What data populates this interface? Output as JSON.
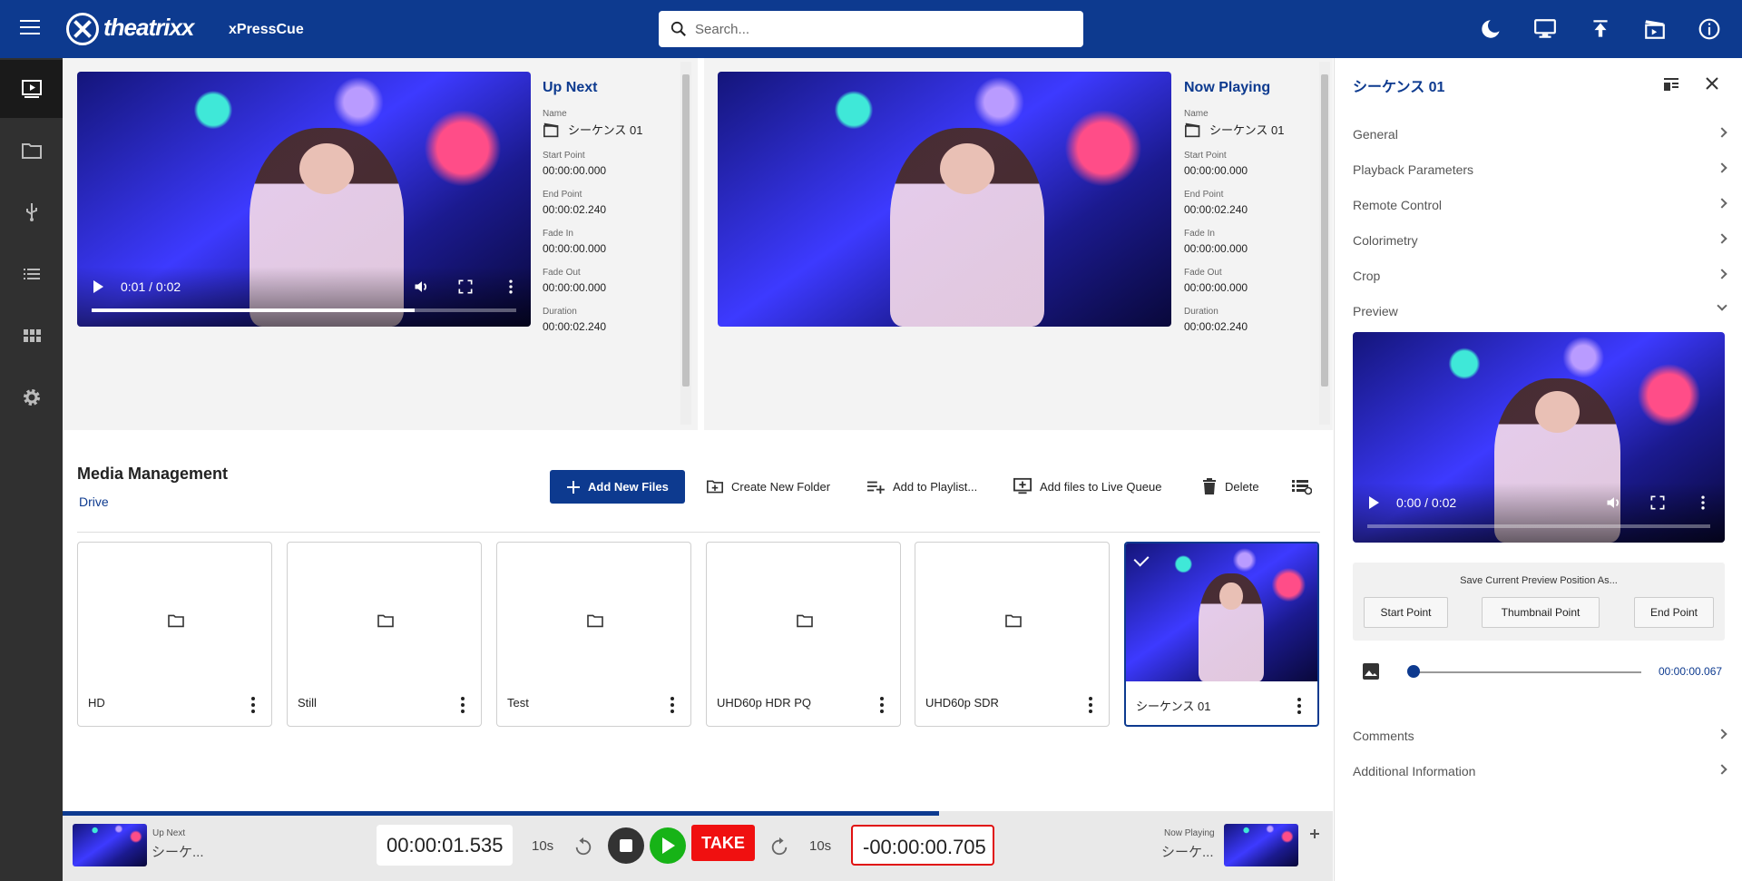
{
  "header": {
    "brand": "theatrixx",
    "app_name": "xPressCue",
    "search_placeholder": "Search..."
  },
  "up_next": {
    "title": "Up Next",
    "name_label": "Name",
    "name": "シーケンス 01",
    "fields": [
      {
        "label": "Start Point",
        "value": "00:00:00.000"
      },
      {
        "label": "End Point",
        "value": "00:00:02.240"
      },
      {
        "label": "Fade In",
        "value": "00:00:00.000"
      },
      {
        "label": "Fade Out",
        "value": "00:00:00.000"
      },
      {
        "label": "Duration",
        "value": "00:00:02.240"
      }
    ],
    "player_time": "0:01 / 0:02",
    "progress": 0.76
  },
  "now_playing": {
    "title": "Now Playing",
    "name_label": "Name",
    "name": "シーケンス 01",
    "fields": [
      {
        "label": "Start Point",
        "value": "00:00:00.000"
      },
      {
        "label": "End Point",
        "value": "00:00:02.240"
      },
      {
        "label": "Fade In",
        "value": "00:00:00.000"
      },
      {
        "label": "Fade Out",
        "value": "00:00:00.000"
      },
      {
        "label": "Duration",
        "value": "00:00:02.240"
      }
    ]
  },
  "media": {
    "title": "Media Management",
    "breadcrumb": "Drive",
    "toolbar": {
      "add_new_files": "Add New Files",
      "create_folder": "Create New Folder",
      "add_playlist": "Add to Playlist...",
      "add_live_queue": "Add files to Live Queue",
      "delete": "Delete"
    },
    "items": [
      {
        "name": "HD",
        "type": "folder"
      },
      {
        "name": "Still",
        "type": "folder"
      },
      {
        "name": "Test",
        "type": "folder"
      },
      {
        "name": "UHD60p HDR PQ",
        "type": "folder"
      },
      {
        "name": "UHD60p SDR",
        "type": "folder"
      },
      {
        "name": "シーケンス 01",
        "type": "video",
        "selected": true
      }
    ]
  },
  "transport": {
    "up_next_label": "Up Next",
    "up_next_name": "シーケ...",
    "now_playing_label": "Now Playing",
    "now_playing_name": "シーケ...",
    "elapsed": "00:00:01.535",
    "remaining": "-00:00:00.705",
    "skip_back": "10s",
    "skip_fwd": "10s",
    "take": "TAKE",
    "progress": 0.69
  },
  "inspector": {
    "title": "シーケンス 01",
    "sections": [
      "General",
      "Playback Parameters",
      "Remote Control",
      "Colorimetry",
      "Crop",
      "Preview"
    ],
    "sections_bottom": [
      "Comments",
      "Additional Information"
    ],
    "player_time": "0:00 / 0:02",
    "save_title": "Save Current Preview Position As...",
    "start_point": "Start Point",
    "thumbnail_point": "Thumbnail Point",
    "end_point": "End Point",
    "scrub_time": "00:00:00.067"
  },
  "colors": {
    "brand": "#0d3a8f",
    "take": "#f01010",
    "play": "#17b317"
  }
}
